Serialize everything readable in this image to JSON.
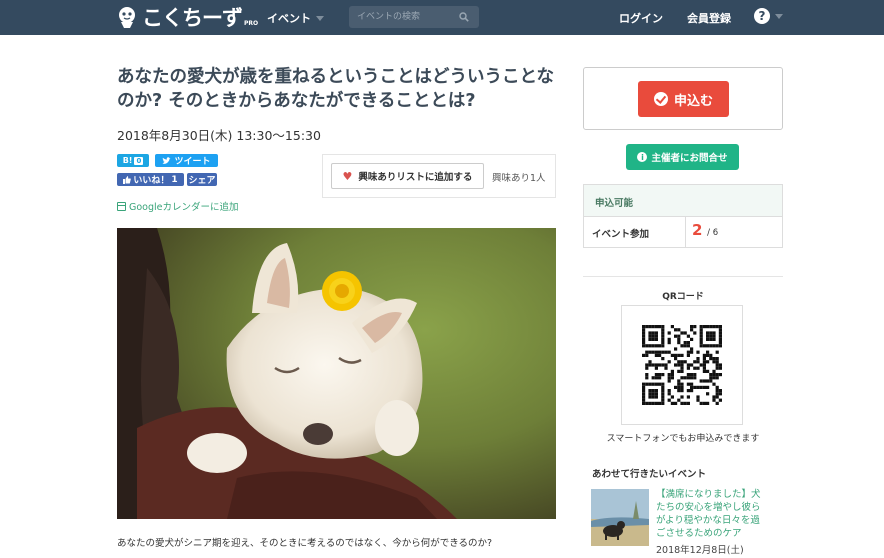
{
  "header": {
    "logo_text": "こくちーず",
    "logo_sub": "PRO",
    "nav_event": "イベント",
    "search_placeholder": "イベントの検索",
    "login": "ログイン",
    "register": "会員登録",
    "help": "?"
  },
  "event": {
    "title": "あなたの愛犬が歳を重ねるということはどういうことなのか? そのときからあなたができることとは?",
    "datetime": "2018年8月30日(木) 13:30〜15:30",
    "description": "あなたの愛犬がシニア期を迎え、そのときに考えるのではなく、今から何ができるのか?"
  },
  "social": {
    "hatena_label": "B!",
    "hatena_count": "0",
    "tweet": "ツイート",
    "like": "いいね！",
    "like_count": "1",
    "share": "シェア",
    "gcal": "Googleカレンダーに追加"
  },
  "interest": {
    "button": "興味ありリストに追加する",
    "count": "興味あり1人"
  },
  "sidebar": {
    "apply": "申込む",
    "contact": "主催者にお問合せ",
    "status_head": "申込可能",
    "status_label": "イベント参加",
    "status_num": "2",
    "status_total": "/ 6",
    "qr_title": "QRコード",
    "qr_caption": "スマートフォンでもお申込みできます",
    "also_title": "あわせて行きたいイベント",
    "also_event": "【満席になりました】犬たちの安心を増やし彼らがより穏やかな日々を過ごさせるためのケア",
    "also_date": "2018年12月8日(土)"
  },
  "colors": {
    "nav_bg": "#344a5f",
    "apply_red": "#e94b3c",
    "contact_green": "#20b487",
    "link_green": "#3aa47a"
  }
}
